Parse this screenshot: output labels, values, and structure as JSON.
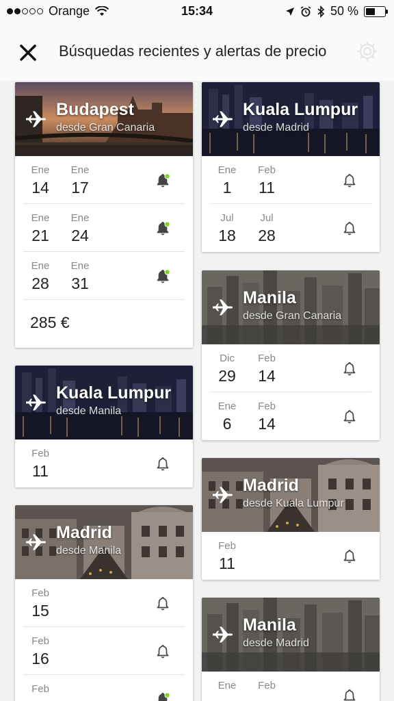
{
  "status_bar": {
    "carrier": "Orange",
    "time": "15:34",
    "battery_text": "50 %",
    "battery_level": 0.5
  },
  "header": {
    "title": "Búsquedas recientes y alertas de precio",
    "close_icon": "close-icon",
    "settings_icon": "gear-icon"
  },
  "cards": [
    {
      "city": "Budapest",
      "from": "desde Gran Canaria",
      "scene": "parliament-bridge-sunset",
      "dates": [
        {
          "m1": "Ene",
          "d1": "14",
          "m2": "Ene",
          "d2": "17",
          "alert_active": true
        },
        {
          "m1": "Ene",
          "d1": "21",
          "m2": "Ene",
          "d2": "24",
          "alert_active": true
        },
        {
          "m1": "Ene",
          "d1": "28",
          "m2": "Ene",
          "d2": "31",
          "alert_active": true
        }
      ],
      "price": "285 €"
    },
    {
      "city": "Kuala Lumpur",
      "from": "desde Madrid",
      "scene": "skyline-night-water",
      "dates": [
        {
          "m1": "Ene",
          "d1": "1",
          "m2": "Feb",
          "d2": "11",
          "alert_active": false
        },
        {
          "m1": "Jul",
          "d1": "18",
          "m2": "Jul",
          "d2": "28",
          "alert_active": false
        }
      ]
    },
    {
      "city": "Manila",
      "from": "desde Gran Canaria",
      "scene": "city-haze",
      "dates": [
        {
          "m1": "Dic",
          "d1": "29",
          "m2": "Feb",
          "d2": "14",
          "alert_active": false
        },
        {
          "m1": "Ene",
          "d1": "6",
          "m2": "Feb",
          "d2": "14",
          "alert_active": false
        }
      ]
    },
    {
      "city": "Kuala Lumpur",
      "from": "desde Manila",
      "scene": "skyline-night-water",
      "dates": [
        {
          "m1": "Feb",
          "d1": "11",
          "alert_active": false
        }
      ]
    },
    {
      "city": "Madrid",
      "from": "desde Kuala Lumpur",
      "scene": "old-city-street",
      "dates": [
        {
          "m1": "Feb",
          "d1": "11",
          "alert_active": false
        }
      ]
    },
    {
      "city": "Madrid",
      "from": "desde Manila",
      "scene": "old-city-street",
      "dates": [
        {
          "m1": "Feb",
          "d1": "15",
          "alert_active": false
        },
        {
          "m1": "Feb",
          "d1": "16",
          "alert_active": false
        },
        {
          "m1": "Feb",
          "d1": "",
          "alert_active": true
        }
      ]
    },
    {
      "city": "Manila",
      "from": "desde Madrid",
      "scene": "city-haze",
      "dates": [
        {
          "m1": "Ene",
          "d1": "",
          "m2": "Feb",
          "d2": "",
          "alert_active": false
        }
      ]
    }
  ],
  "colors": {
    "alert_dot": "#7ed321",
    "background": "#f2f2f2"
  }
}
